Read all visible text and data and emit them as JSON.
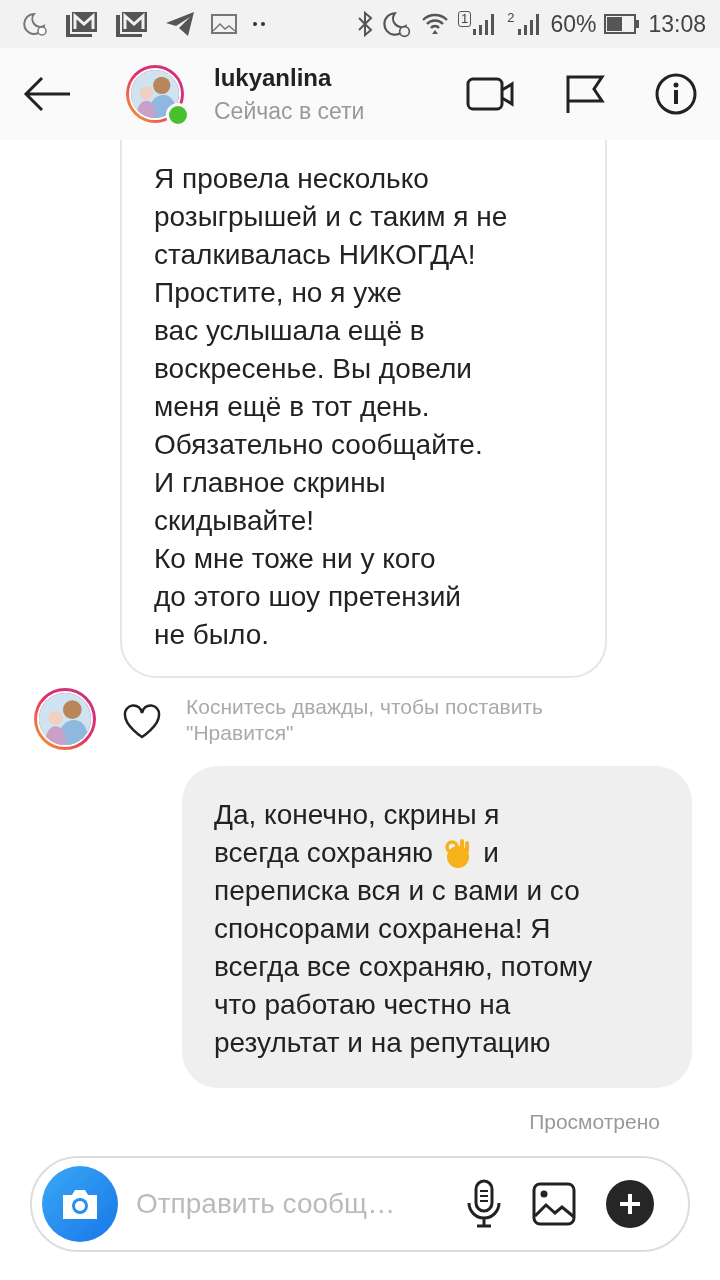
{
  "status_bar": {
    "sim_1": "1",
    "sim_2": "2",
    "battery": "60%",
    "time": "13:08"
  },
  "header": {
    "username": "lukyanlina",
    "status": "Сейчас в сети",
    "online": true
  },
  "messages": [
    {
      "kind": "received",
      "parts": [
        {
          "kind": "text",
          "text": "Я провела несколько\nрозыгрышей и с таким я не\nсталкивалась НИКОГДА!\nПростите, но я уже\nвас услышала ещё в\nвоскресенье. Вы довели\nменя ещё в тот день.\nОбязательно сообщайте.\nИ главное скрины\nскидывайте!\nКо мне тоже ни у кого\nдо этого шоу претензий\nне было."
        }
      ],
      "hint": "Коснитесь дважды, чтобы поставить\n\"Нравится\"",
      "liked": false
    },
    {
      "kind": "sent",
      "lines": [
        [
          {
            "kind": "text",
            "text": "Да, конечно, скрины я"
          }
        ],
        [
          {
            "kind": "text",
            "text": "всегда сохраняю"
          },
          {
            "kind": "emoji"
          },
          {
            "kind": "text",
            "text": "и"
          }
        ],
        [
          {
            "kind": "text",
            "text": "переписка вся и с вами и со\nспонсорами сохранена! Я\nвсегда все сохраняю, потому\nчто работаю честно на\nрезультат и на репутацию"
          }
        ]
      ]
    }
  ],
  "seen": "Просмотрено",
  "composer": {
    "placeholder": "Отправить сообщ…"
  }
}
